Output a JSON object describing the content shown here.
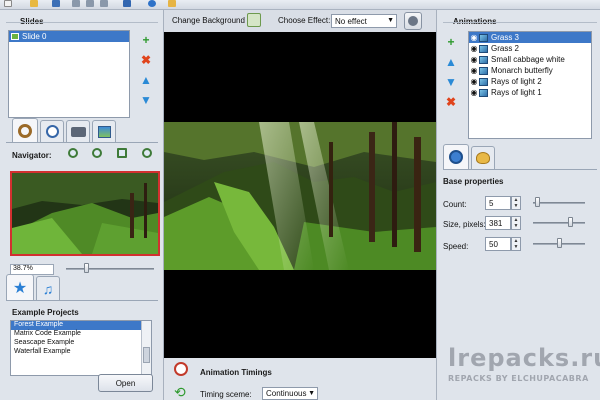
{
  "header": {
    "change_background_label": "Change Background",
    "choose_effect_label": "Choose Effect:",
    "effect_value": "No effect"
  },
  "slides": {
    "title": "Slides",
    "items": [
      {
        "label": "Slide 0",
        "selected": true
      }
    ]
  },
  "navigator": {
    "title": "Navigator:",
    "zoom_value": "38.7%"
  },
  "projects": {
    "title": "Example Projects",
    "items": [
      {
        "label": "Forest Example",
        "selected": true
      },
      {
        "label": "Matrix Code Example",
        "selected": false
      },
      {
        "label": "Seascape Example",
        "selected": false
      },
      {
        "label": "Waterfall Example",
        "selected": false
      }
    ],
    "open_label": "Open"
  },
  "animations": {
    "title": "Animations",
    "items": [
      {
        "label": "Grass 3",
        "selected": true
      },
      {
        "label": "Grass 2",
        "selected": false
      },
      {
        "label": "Small cabbage white",
        "selected": false
      },
      {
        "label": "Monarch butterfly",
        "selected": false
      },
      {
        "label": "Rays of light 2",
        "selected": false
      },
      {
        "label": "Rays of light 1",
        "selected": false
      }
    ]
  },
  "base_properties": {
    "title": "Base properties",
    "count_label": "Count:",
    "count_value": "5",
    "count_slider": 0.05,
    "size_label": "Size, pixels:",
    "size_value": "381",
    "size_slider": 0.75,
    "speed_label": "Speed:",
    "speed_value": "50",
    "speed_slider": 0.5
  },
  "timings": {
    "title": "Animation Timings",
    "scheme_label": "Timing sceme:",
    "scheme_value": "Continuous"
  },
  "watermark": {
    "main": "lrepacks.ru",
    "sub": "REPACKS BY ELCHUPACABRA"
  },
  "colors": {
    "accent_blue": "#3d78c8",
    "add_green": "#2e9a2e",
    "delete_red": "#e0441c",
    "arrow_blue": "#2a8ad6"
  }
}
